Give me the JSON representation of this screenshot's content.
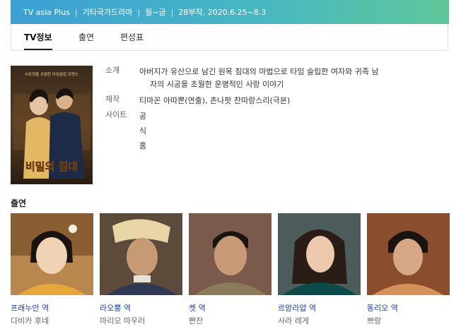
{
  "header": {
    "channel": "TV asia Plus",
    "genre": "기타국가드라마",
    "schedule": "월~금",
    "episodes": "28부작, 2020.6.25~8.3"
  },
  "tabs": [
    {
      "label": "TV정보",
      "active": true
    },
    {
      "label": "출연",
      "active": false
    },
    {
      "label": "편성표",
      "active": false
    }
  ],
  "poster": {
    "tagline": "사유정을 초월한 타임슬립 로맨스",
    "title_art": "비밀의 침대"
  },
  "info": {
    "intro_label": "소개",
    "intro_line1": "아버지가 유산으로 남긴 원목 침대의 마법으로 타임 슬립한 여자와 귀족 남",
    "intro_line2": "자의 시공을 초월한 운명적인 사랑 이야기",
    "production_label": "제작",
    "production_value": "티마꼰 아따뽄(연출), 촌나팟 찬따랑스리(극본)",
    "site_label": "사이트",
    "site_link": "공식홈"
  },
  "cast_heading": "출연",
  "cast": [
    {
      "role": "프래누안 역",
      "actor": "다비카 후네"
    },
    {
      "role": "라오뿡 역",
      "actor": "마리오 마우러"
    },
    {
      "role": "켓 역",
      "actor": "빤잔"
    },
    {
      "role": "르앙라얍 역",
      "actor": "사라 레게"
    },
    {
      "role": "똥리오 역",
      "actor": "쁘랑"
    }
  ],
  "colors": {
    "header_start": "#3d9fd4",
    "header_end": "#5fc79a",
    "link": "#1a3fa6"
  }
}
